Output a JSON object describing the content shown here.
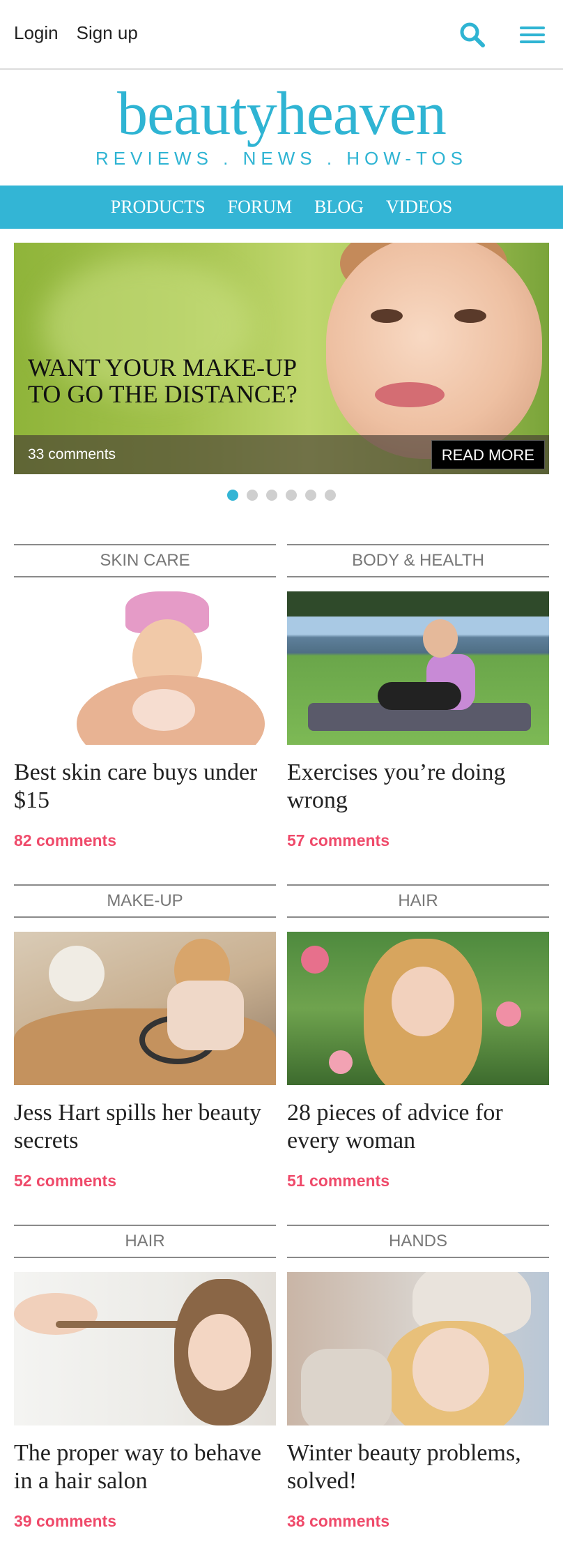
{
  "topbar": {
    "login": "Login",
    "signup": "Sign up",
    "search_icon": "search-icon",
    "menu_icon": "hamburger-menu-icon"
  },
  "logo": {
    "name": "beautyheaven",
    "tagline": "REVIEWS . NEWS . HOW-TOS"
  },
  "nav": {
    "items": [
      "PRODUCTS",
      "FORUM",
      "BLOG",
      "VIDEOS"
    ]
  },
  "hero": {
    "title_line1": "WANT YOUR MAKE-UP",
    "title_line2": "TO GO THE DISTANCE?",
    "comments": "33 comments",
    "read_more": "READ MORE",
    "slide_count": 6,
    "active_slide": 1
  },
  "colors": {
    "brand": "#33b5d5",
    "comments": "#ef4a6a",
    "category": "#777777"
  },
  "articles": [
    {
      "category": "SKIN CARE",
      "title": "Best skin care buys under $15",
      "comments": "82 comments"
    },
    {
      "category": "BODY & HEALTH",
      "title": "Exercises you’re doing wrong",
      "comments": "57 comments"
    },
    {
      "category": "MAKE-UP",
      "title": "Jess Hart spills her beauty secrets",
      "comments": "52 comments"
    },
    {
      "category": "HAIR",
      "title": "28 pieces of advice for every woman",
      "comments": "51 comments"
    },
    {
      "category": "HAIR",
      "title": "The proper way to behave in a hair salon",
      "comments": "39 comments"
    },
    {
      "category": "HANDS",
      "title": "Winter beauty problems, solved!",
      "comments": "38 comments"
    }
  ]
}
